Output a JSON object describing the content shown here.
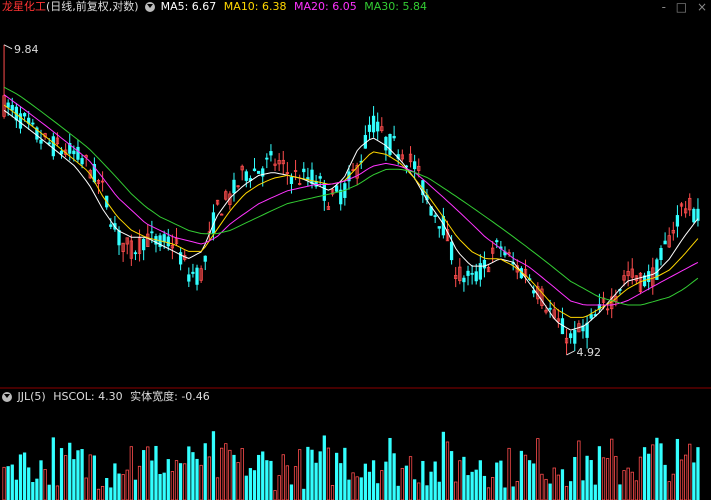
{
  "header": {
    "stock_name": "龙星化工",
    "mode": "(日线,前复权,对数)",
    "ma": [
      {
        "label": "MA5: 6.67",
        "color": "#ffffff"
      },
      {
        "label": "MA10: 6.38",
        "color": "#ffd700"
      },
      {
        "label": "MA20: 6.05",
        "color": "#ff33ff"
      },
      {
        "label": "MA30: 5.84",
        "color": "#33cc33"
      }
    ],
    "window_buttons": [
      "-",
      "□",
      "×"
    ]
  },
  "sub_header": {
    "indicator": "JJL(5)",
    "hscol": "HSCOL: 4.30",
    "body_width": "实体宽度: -0.46"
  },
  "colors": {
    "up": "#ff4d4d",
    "down": "#33ffff",
    "ma5": "#ffffff",
    "ma10": "#ffd700",
    "ma20": "#ff33ff",
    "ma30": "#33cc33",
    "background": "#000000",
    "divider": "#8b0000"
  },
  "chart_data": {
    "type": "candlestick",
    "scale": "log",
    "ylim": [
      4.6,
      10.4
    ],
    "annotations": [
      {
        "text": "9.84",
        "kind": "max",
        "value": 9.84
      },
      {
        "text": "4.92",
        "kind": "min",
        "value": 4.92
      }
    ],
    "price_anchors": [
      8.6,
      8.4,
      8.1,
      7.9,
      7.8,
      7.7,
      7.5,
      7.1,
      6.4,
      6.2,
      6.4,
      6.3,
      6.35,
      5.9,
      5.9,
      6.8,
      7.0,
      7.4,
      7.45,
      7.6,
      7.4,
      7.3,
      7.3,
      6.95,
      7.1,
      7.5,
      8.3,
      7.9,
      7.8,
      7.5,
      6.9,
      6.6,
      5.9,
      5.8,
      6.0,
      6.3,
      6.0,
      5.9,
      5.6,
      5.3,
      5.1,
      5.2,
      5.4,
      5.6,
      5.9,
      5.8,
      5.9,
      6.4,
      6.9,
      6.7
    ],
    "ma_anchors": {
      "MA5": [
        8.5,
        8.3,
        8.1,
        7.9,
        7.7,
        7.5,
        7.2,
        6.8,
        6.5,
        6.4,
        6.4,
        6.3,
        6.2,
        6.1,
        6.2,
        6.7,
        7.0,
        7.2,
        7.35,
        7.4,
        7.35,
        7.3,
        7.2,
        7.1,
        7.3,
        7.8,
        8.0,
        7.85,
        7.6,
        7.3,
        6.9,
        6.6,
        6.2,
        6.0,
        6.0,
        6.1,
        6.05,
        5.8,
        5.55,
        5.3,
        5.2,
        5.25,
        5.4,
        5.6,
        5.8,
        5.85,
        5.9,
        6.1,
        6.4,
        6.67
      ],
      "MA10": [
        8.6,
        8.4,
        8.2,
        8.0,
        7.8,
        7.6,
        7.4,
        7.0,
        6.7,
        6.5,
        6.4,
        6.35,
        6.3,
        6.2,
        6.2,
        6.5,
        6.8,
        7.05,
        7.2,
        7.3,
        7.35,
        7.3,
        7.25,
        7.2,
        7.25,
        7.5,
        7.75,
        7.7,
        7.55,
        7.3,
        7.0,
        6.7,
        6.4,
        6.2,
        6.1,
        6.1,
        6.0,
        5.85,
        5.65,
        5.45,
        5.35,
        5.35,
        5.45,
        5.55,
        5.7,
        5.8,
        5.85,
        5.95,
        6.15,
        6.38
      ],
      "MA20": [
        8.8,
        8.6,
        8.4,
        8.2,
        8.0,
        7.8,
        7.6,
        7.3,
        7.0,
        6.8,
        6.6,
        6.5,
        6.4,
        6.35,
        6.3,
        6.4,
        6.6,
        6.75,
        6.9,
        7.0,
        7.1,
        7.15,
        7.2,
        7.2,
        7.25,
        7.35,
        7.5,
        7.55,
        7.5,
        7.4,
        7.2,
        7.0,
        6.8,
        6.6,
        6.4,
        6.25,
        6.1,
        6.0,
        5.85,
        5.7,
        5.55,
        5.5,
        5.5,
        5.5,
        5.55,
        5.65,
        5.75,
        5.85,
        5.95,
        6.05
      ],
      "MA30": [
        8.95,
        8.8,
        8.6,
        8.4,
        8.2,
        8.0,
        7.8,
        7.55,
        7.3,
        7.05,
        6.85,
        6.7,
        6.6,
        6.5,
        6.45,
        6.45,
        6.5,
        6.6,
        6.7,
        6.8,
        6.9,
        6.95,
        7.0,
        7.05,
        7.1,
        7.2,
        7.35,
        7.45,
        7.45,
        7.4,
        7.3,
        7.15,
        7.0,
        6.85,
        6.7,
        6.55,
        6.4,
        6.25,
        6.1,
        5.95,
        5.8,
        5.7,
        5.6,
        5.55,
        5.5,
        5.5,
        5.55,
        5.6,
        5.7,
        5.84
      ]
    },
    "volume_note": "volume bars colored by candle direction"
  }
}
